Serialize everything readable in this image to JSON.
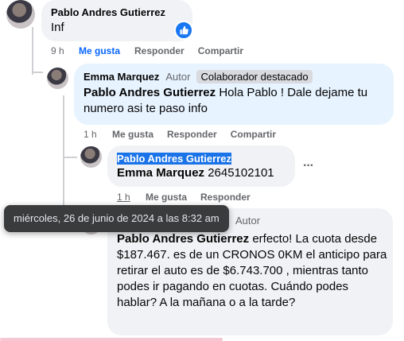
{
  "comment1": {
    "author": "Pablo Andres Gutierrez",
    "text": "Inf",
    "time": "9 h",
    "like": "Me gusta",
    "reply": "Responder",
    "share": "Compartir",
    "reaction_color": "#1877f2"
  },
  "comment2": {
    "author": "Emma Marquez",
    "author_badge": "Autor",
    "role_badge": "Colaborador destacado",
    "mention": "Pablo Andres Gutierrez",
    "text": " Hola Pablo ! Dale dejame tu numero asi te paso info",
    "time": "1 h",
    "like": "Me gusta",
    "reply": "Responder",
    "share": "Compartir"
  },
  "comment3": {
    "author": "Pablo Andres Gutierrez",
    "mention": "Emma Marquez",
    "text": " 2645102101",
    "time": "1 h",
    "like": "Me gusta",
    "reply": "Responder",
    "more": "···"
  },
  "comment4": {
    "author_badge": "Autor",
    "mention": "Pablo Andres Gutierrez",
    "text": " erfecto! La cuota desde $187.467. es de un CRONOS 0KM el anticipo para retirar el auto es de $6.743.700 , mientras tanto podes ir pagando en cuotas. Cuándo podes hablar? A la mañana o a la tarde?"
  },
  "tooltip": {
    "text": "miércoles, 26 de junio de 2024 a las 8:32 am"
  }
}
